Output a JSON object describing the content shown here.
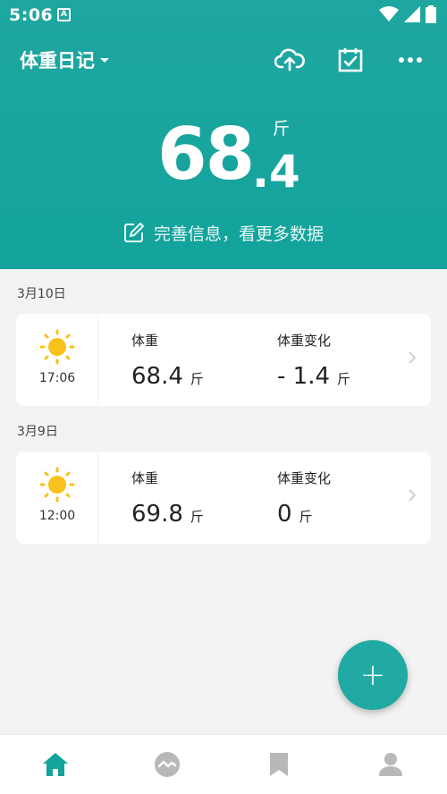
{
  "status_bar": {
    "time": "5:06",
    "a_badge": "A"
  },
  "appbar": {
    "title": "体重日记",
    "icons": [
      "cloud-upload-icon",
      "calendar-check-icon",
      "more-icon"
    ]
  },
  "hero": {
    "int": "68",
    "dec": ".4",
    "unit": "斤"
  },
  "improve_link": "完善信息，看更多数据",
  "records": [
    {
      "date": "3月10日",
      "time": "17:06",
      "weight_label": "体重",
      "weight_value": "68.4",
      "weight_unit": "斤",
      "change_label": "体重变化",
      "change_value": "- 1.4",
      "change_unit": "斤"
    },
    {
      "date": "3月9日",
      "time": "12:00",
      "weight_label": "体重",
      "weight_value": "69.8",
      "weight_unit": "斤",
      "change_label": "体重变化",
      "change_value": "0",
      "change_unit": "斤"
    }
  ],
  "fab_label": "+",
  "colors": {
    "accent": "#13a39c",
    "fab": "#21aaa4",
    "sun": "#f7c21b"
  },
  "bottom_nav": [
    "home-icon",
    "trend-icon",
    "bookmark-icon",
    "profile-icon"
  ]
}
